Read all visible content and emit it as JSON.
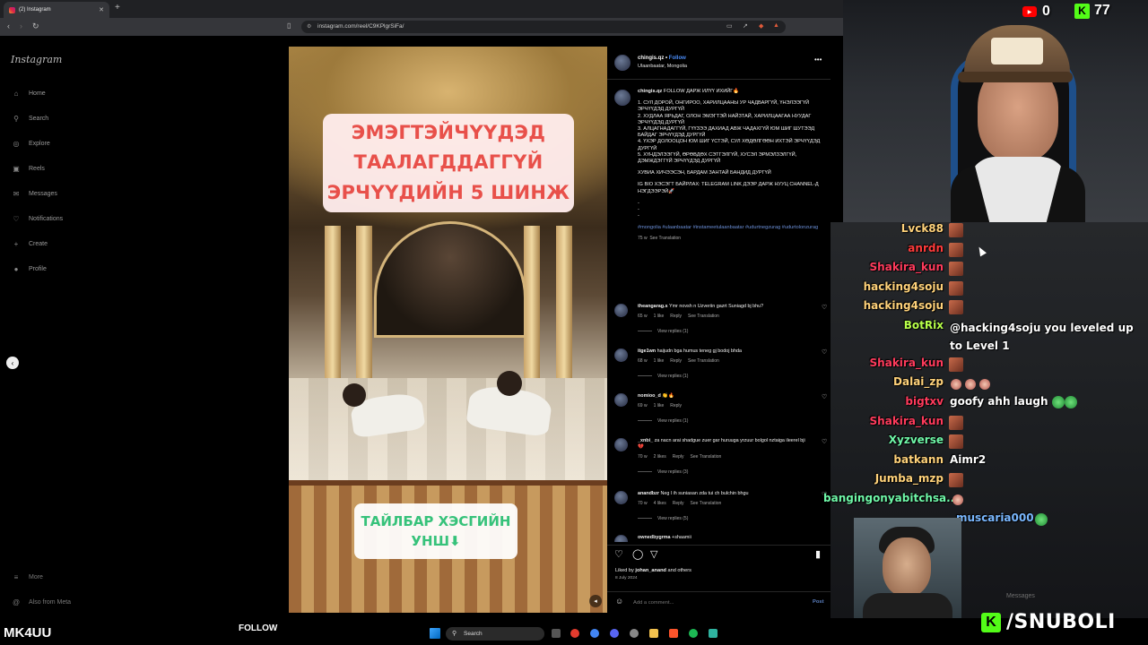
{
  "browser": {
    "tab_title": "(2) Instagram",
    "url": "instagram.com/reel/C9KPlgrSiFa/"
  },
  "sidebar": {
    "logo": "Instagram",
    "items": [
      {
        "label": "Home",
        "icon": "home-icon",
        "glyph": "⌂"
      },
      {
        "label": "Search",
        "icon": "search-icon",
        "glyph": "⚲"
      },
      {
        "label": "Explore",
        "icon": "explore-icon",
        "glyph": "◎"
      },
      {
        "label": "Reels",
        "icon": "reels-icon",
        "glyph": "▣"
      },
      {
        "label": "Messages",
        "icon": "messages-icon",
        "glyph": "✉"
      },
      {
        "label": "Notifications",
        "icon": "heart-icon",
        "glyph": "♡"
      },
      {
        "label": "Create",
        "icon": "plus-icon",
        "glyph": "+"
      },
      {
        "label": "Profile",
        "icon": "profile-icon",
        "glyph": "●"
      }
    ],
    "more": "More",
    "also_from_meta": "Also from Meta"
  },
  "video": {
    "title_lines": [
      "ЭМЭГТЭЙЧҮҮДЭД",
      "ТААЛАГДДАГГҮЙ",
      "ЭРЧҮҮДИЙН 5 ШИНЖ"
    ],
    "subtitle_lines": [
      "ТАЙЛБАР ХЭСГИЙН",
      "УНШ⬇"
    ]
  },
  "post": {
    "username": "chingis.qz",
    "follow": "Follow",
    "location": "Ulaanbaatar, Mongolia",
    "caption": {
      "intro": "FOLLOW ДАРЖ ИЛҮҮ ИХИЙГ🔥",
      "points": [
        "1. СУЛ ДОРОЙ, ОНГИРОО, ХАРИЛЦААНЫ УР ЧАДВАРГҮЙ, ҮНЭЛЭЭГҮЙ ЭРЧҮҮДЭД ДУРГҮЙ",
        "2. ХУДЛАА ЯРЬДАГ, ОЛОН ЭМЭГТЭЙ НАЙЗТАЙ, ХАРИЛЦААГАА НУУДАГ ЭРЧҮҮДЭД ДУРГҮЙ",
        "3. АЛЦАГНАДАГГҮЙ, ГҮҮЗЭЭ ДАХИАД АВЖ ЧАДАХГҮЙ ЮМ ШИГ ШУТЭЭД БАЙДАГ ЭРЧҮҮДЭД ДУРГҮЙ",
        "4. ҮХЭР ДОЛООЦОН ЮМ ШИГ ҮСТЭЙ, СУЛ ХӨДӨЛГӨӨН ИХТЭЙ ЭРЧҮҮДЭД ДУРГҮЙ",
        "5. ХҮНДЭЛЭЭГҮЙ, ӨРӨВДӨХ СЭТГЭЛГҮЙ, ХУСЭЛ ЭРМЭЛЗЭЛГҮЙ, ДЭМЖДЭГГҮЙ ЭРЧҮҮДЭД ДУРГҮЙ"
      ],
      "closing": "ХУВИА ХИЧЭЭСЭН, БАРДАМ ЗАНТАЙ БАНДИД ДУРГҮЙ",
      "link": "IG BIO ХЭСЭГТ БАЙРЛАХ: TELEGRAM LINK ДЭЭР ДАРЖ НУУЦ CHANNEL-Д НЭГДЭЭРЭЙ🚀",
      "dashes": [
        "-",
        "-",
        "-"
      ],
      "tags": "#mongolia #ulaanbaatar #instameetulaanbaatar #udurtnegzurag #udurtolonzurag",
      "time": "75 w",
      "translation": "See Translation"
    },
    "comments": [
      {
        "user": "theangarag.s",
        "text": "Ymr novsh n Uzveriin gazrt Suniagd bj bhu?",
        "meta": [
          "65 w",
          "1 like",
          "Reply",
          "See Translation"
        ],
        "replies": "View replies (1)"
      },
      {
        "user": "itge1wn",
        "text": "haijudn bga humus teneg gj bodoj bhda",
        "meta": [
          "68 w",
          "1 like",
          "Reply",
          "See Translation"
        ],
        "replies": "View replies (1)"
      },
      {
        "user": "nomioo_d",
        "text": "👏🔥",
        "meta": [
          "69 w",
          "1 like",
          "Reply"
        ],
        "replies": "View replies (1)"
      },
      {
        "user": "_xnbi_",
        "text": "za nacn arai shadgue zuer gar huruuga yrzuur bolgol nztaiga ileerel bji 💔",
        "meta": [
          "70 w",
          "2 likes",
          "Reply",
          "See Translation"
        ],
        "replies": "View replies (3)"
      },
      {
        "user": "anandbzr",
        "text": "Neg l ih suniasan zda tui ch bulchin bhgu",
        "meta": [
          "70 w",
          "4 likes",
          "Reply",
          "See Translation"
        ],
        "replies": "View replies (5)"
      },
      {
        "user": "ownedbygrma",
        "text": "+shaamii",
        "meta": [],
        "replies": ""
      }
    ],
    "liked_by_prefix": "Liked by",
    "liked_by_user": "johan_anand",
    "liked_by_suffix": "and others",
    "date": "8 July 2024",
    "add_comment_placeholder": "Add a comment...",
    "post_button": "Post"
  },
  "stream": {
    "youtube_count": "0",
    "kick_count": "77",
    "streamer_name": "MK4UU",
    "follow_label": "FOLLOW",
    "kick_handle": "/SNUBOLI",
    "messages_label": "Messages",
    "chat": [
      {
        "user": "Lvck88",
        "color": "#ffd27a",
        "text": "",
        "emote": "e"
      },
      {
        "user": "anrdn",
        "color": "#ff3b3b",
        "text": "",
        "emote": "e"
      },
      {
        "user": "Shakira_kun",
        "color": "#ff3b5c",
        "text": "",
        "emote": "e"
      },
      {
        "user": "hacking4soju",
        "color": "#ffd27a",
        "text": "",
        "emote": "e"
      },
      {
        "user": "hacking4soju",
        "color": "#ffd27a",
        "text": "",
        "emote": "e"
      },
      {
        "user": "BotRix",
        "color": "#b7ff4a",
        "text": "@hacking4soju you leveled up to Level 1",
        "emote": ""
      },
      {
        "user": "Shakira_kun",
        "color": "#ff3b5c",
        "text": "",
        "emote": "e"
      },
      {
        "user": "Dalai_zp",
        "color": "#ffd27a",
        "text": "",
        "emote": "ppp"
      },
      {
        "user": "bigtxv",
        "color": "#ff3b5c",
        "text": "goofy ahh laugh",
        "emote": "gg"
      },
      {
        "user": "Shakira_kun",
        "color": "#ff3b5c",
        "text": "",
        "emote": "e"
      },
      {
        "user": "Xyzverse",
        "color": "#6ff7a8",
        "text": "",
        "emote": "e"
      },
      {
        "user": "batkann",
        "color": "#ffd27a",
        "text": "Aimr2",
        "emote": ""
      },
      {
        "user": "Jumba_mzp",
        "color": "#ffd27a",
        "text": "",
        "emote": "e"
      },
      {
        "user": "bangingonyabitchsa...",
        "color": "#6ff7a8",
        "text": "",
        "emote": "p"
      },
      {
        "user": "muscaria000",
        "color": "#7ab8ff",
        "text": "",
        "emote": "g"
      }
    ]
  },
  "taskbar": {
    "search_label": "Search"
  },
  "colors": {
    "instagram_link": "#4a8cf7",
    "kick_green": "#53fc18",
    "youtube_red": "#ff0000"
  }
}
